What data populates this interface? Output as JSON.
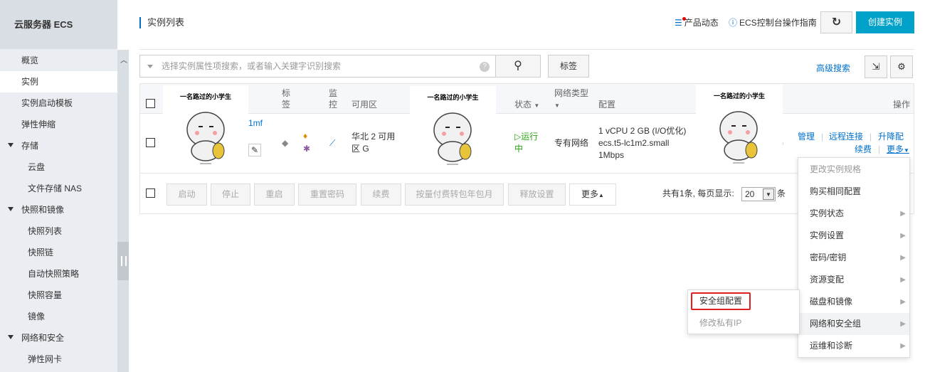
{
  "sidebar": {
    "title": "云服务器 ECS",
    "items": [
      {
        "label": "概览"
      },
      {
        "label": "实例"
      },
      {
        "label": "实例启动模板"
      },
      {
        "label": "弹性伸缩"
      },
      {
        "label": "存储"
      },
      {
        "label": "云盘"
      },
      {
        "label": "文件存储 NAS"
      },
      {
        "label": "快照和镜像"
      },
      {
        "label": "快照列表"
      },
      {
        "label": "快照链"
      },
      {
        "label": "自动快照策略"
      },
      {
        "label": "快照容量"
      },
      {
        "label": "镜像"
      },
      {
        "label": "网络和安全"
      },
      {
        "label": "弹性网卡"
      }
    ]
  },
  "header": {
    "title": "实例列表",
    "product_news": "产品动态",
    "ecs_guide": "ECS控制台操作指南",
    "create_instance": "创建实例"
  },
  "search": {
    "placeholder": "选择实例属性项搜索，或者输入关键字识别搜索",
    "help": "?",
    "tag_button": "标签",
    "advanced": "高级搜索"
  },
  "table": {
    "headers": {
      "tag": "标签",
      "monitor": "监控",
      "zone": "可用区",
      "status": "状态",
      "network": "网络类型",
      "config": "配置",
      "actions": "操作"
    },
    "row": {
      "id_fragment": "1mf",
      "zone": "华北 2 可用区 G",
      "status": "运行中",
      "network": "专有网络",
      "config_line1": "1 vCPU 2 GB (I/O优化)",
      "config_line2": "ecs.t5-lc1m2.small",
      "config_line3": "1Mbps",
      "paren": ")",
      "action_manage": "管理",
      "action_remote": "远程连接",
      "action_upgrade": "升降配",
      "action_renew": "续费",
      "action_more": "更多"
    },
    "sticker_caption": "一名路过的小学生"
  },
  "footer": {
    "buttons": [
      "启动",
      "停止",
      "重启",
      "重置密码",
      "续费",
      "按量付费转包年包月",
      "释放设置"
    ],
    "more": "更多",
    "pagination_text": "共有1条, 每页显示:",
    "page_size": "20",
    "unit": "条"
  },
  "more_menu": {
    "items": [
      {
        "label": "更改实例规格",
        "disabled": true
      },
      {
        "label": "购买相同配置",
        "disabled": false
      },
      {
        "label": "实例状态",
        "disabled": false
      },
      {
        "label": "实例设置",
        "disabled": false
      },
      {
        "label": "密码/密钥",
        "disabled": false
      },
      {
        "label": "资源变配",
        "disabled": false
      },
      {
        "label": "磁盘和镜像",
        "disabled": false
      },
      {
        "label": "网络和安全组",
        "disabled": false
      },
      {
        "label": "运维和诊断",
        "disabled": false
      }
    ]
  },
  "sub_menu": {
    "items": [
      {
        "label": "安全组配置",
        "disabled": false
      },
      {
        "label": "修改私有IP",
        "disabled": true
      }
    ]
  },
  "colors": {
    "accent": "#0070cc",
    "primary_button": "#00a2ca",
    "running": "#2aa515",
    "highlight": "#e02020"
  }
}
